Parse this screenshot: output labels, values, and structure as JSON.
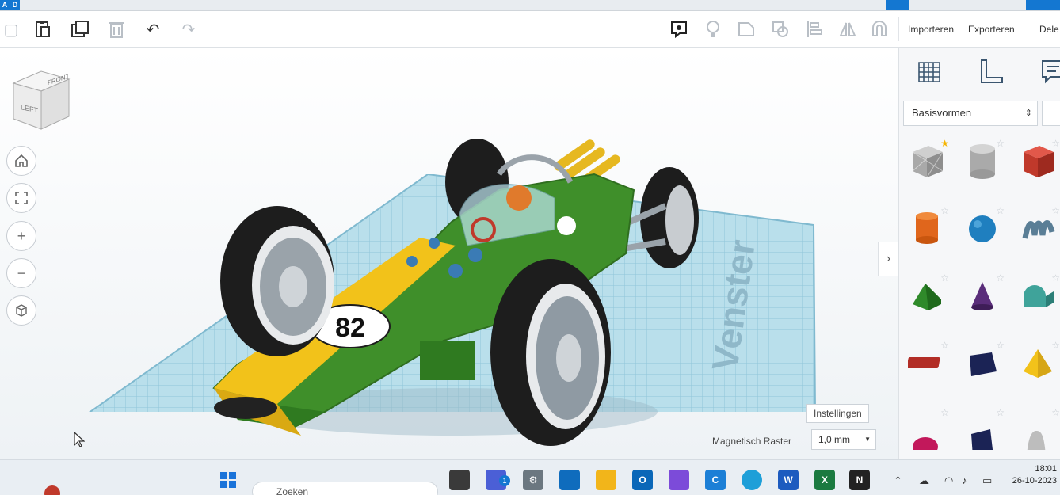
{
  "app": {
    "logo_letters": [
      "A",
      "D"
    ]
  },
  "toolbar": {
    "import_label": "Importeren",
    "export_label": "Exporteren",
    "share_label": "Dele"
  },
  "viewcube": {
    "left_face": "LEFT",
    "front_face": "FRONT"
  },
  "model": {
    "car_number": "82",
    "colors": {
      "body": "#3f8f2a",
      "stripe": "#f2c21a",
      "tire": "#1d1d1d",
      "grid": "#a9d7e6"
    }
  },
  "workplane": {
    "watermark": "Venster"
  },
  "grid_settings": {
    "settings_label": "Instellingen",
    "snap_label": "Magnetisch Raster",
    "snap_value": "1,0 mm"
  },
  "panel": {
    "shape_category": "Basisvormen",
    "shapes": [
      {
        "name": "box-hole",
        "fav": true
      },
      {
        "name": "cylinder-hole",
        "fav": false
      },
      {
        "name": "box",
        "fav": false
      },
      {
        "name": "cylinder",
        "fav": false
      },
      {
        "name": "sphere",
        "fav": false
      },
      {
        "name": "scribble",
        "fav": false
      },
      {
        "name": "roof",
        "fav": false
      },
      {
        "name": "cone",
        "fav": false
      },
      {
        "name": "round-roof",
        "fav": false
      },
      {
        "name": "text",
        "fav": false
      },
      {
        "name": "wedge",
        "fav": false
      },
      {
        "name": "pyramid",
        "fav": false
      },
      {
        "name": "half-sphere",
        "fav": false
      },
      {
        "name": "polygon",
        "fav": false
      },
      {
        "name": "paraboloid",
        "fav": false
      }
    ]
  },
  "taskbar": {
    "search_placeholder": "Zoeken",
    "time": "18:01",
    "date": "26-10-2023",
    "notification_count": "1"
  }
}
